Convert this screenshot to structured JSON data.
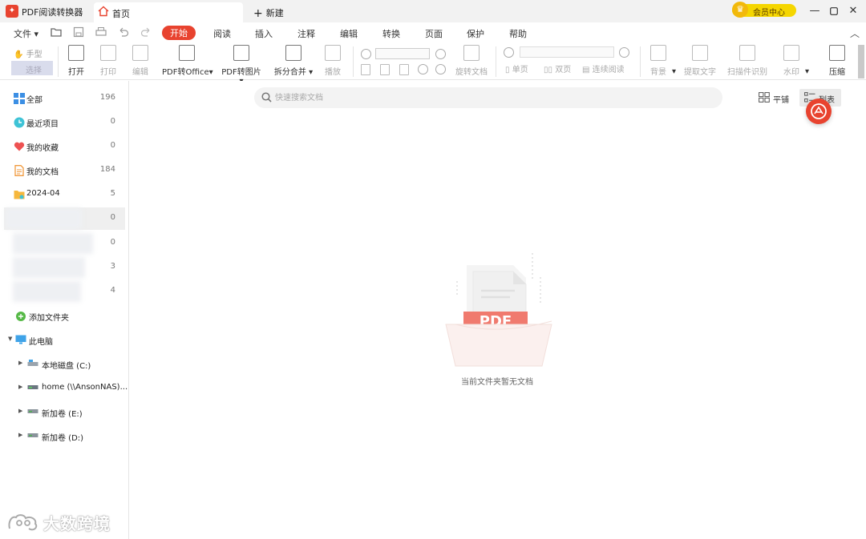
{
  "titlebar": {
    "app_title": "PDF阅读转换器",
    "tab_home": "首页",
    "tab_new": "新建",
    "vip_label": "会员中心",
    "colors": {
      "accent": "#e8432f",
      "vip": "#f5d600"
    }
  },
  "menubar": {
    "file": "文件",
    "tabs": [
      "开始",
      "阅读",
      "插入",
      "注释",
      "编辑",
      "转换",
      "页面",
      "保护",
      "帮助"
    ]
  },
  "ribbon": {
    "hand": "手型",
    "select": "选择",
    "open": "打开",
    "print": "打印",
    "edit": "编辑",
    "pdf_to_office": "PDF转Office",
    "pdf_to_image": "PDF转图片",
    "split_merge": "拆分合并",
    "play": "播放",
    "rotate_doc": "旋转文档",
    "single_page": "单页",
    "double_page": "双页",
    "continuous": "连续阅读",
    "background": "背景",
    "extract_text": "提取文字",
    "ocr": "扫描件识别",
    "watermark": "水印",
    "compress": "压缩"
  },
  "sidebar": {
    "items": [
      {
        "label": "全部",
        "count": "196",
        "icon": "grid-icon"
      },
      {
        "label": "最近项目",
        "count": "0",
        "icon": "clock-icon"
      },
      {
        "label": "我的收藏",
        "count": "0",
        "icon": "heart-icon"
      },
      {
        "label": "我的文档",
        "count": "184",
        "icon": "document-icon"
      },
      {
        "label": "2024-04",
        "count": "5",
        "icon": "folder-icon"
      }
    ],
    "hidden_counts": [
      "0",
      "0",
      "3",
      "4"
    ],
    "add_folder": "添加文件夹",
    "this_pc": "此电脑",
    "drives": [
      {
        "label": "本地磁盘 (C:)"
      },
      {
        "label": "home (\\\\AnsonNAS)..."
      },
      {
        "label": "新加卷 (E:)"
      },
      {
        "label": "新加卷 (D:)"
      }
    ]
  },
  "main": {
    "search_placeholder": "快速搜索文档",
    "view_tile": "平铺",
    "view_list": "列表",
    "empty_text": "当前文件夹暂无文档",
    "empty_badge": "PDF"
  },
  "watermark": {
    "text": "大数跨境"
  }
}
